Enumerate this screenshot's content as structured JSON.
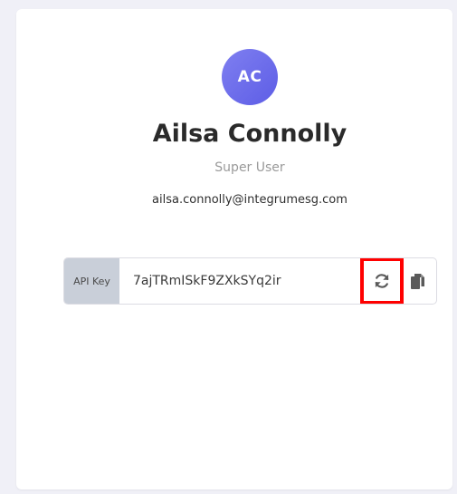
{
  "profile": {
    "initials": "AC",
    "name": "Ailsa Connolly",
    "role": "Super User",
    "email": "ailsa.connolly@integrumesg.com",
    "avatar_color": "#6a6aee"
  },
  "api_key": {
    "label": "API Key",
    "value": "7ajTRmISkF9ZXkSYq2ir",
    "regenerate_icon": "refresh-icon",
    "copy_icon": "copy-icon",
    "highlight_color": "#ff0000"
  }
}
